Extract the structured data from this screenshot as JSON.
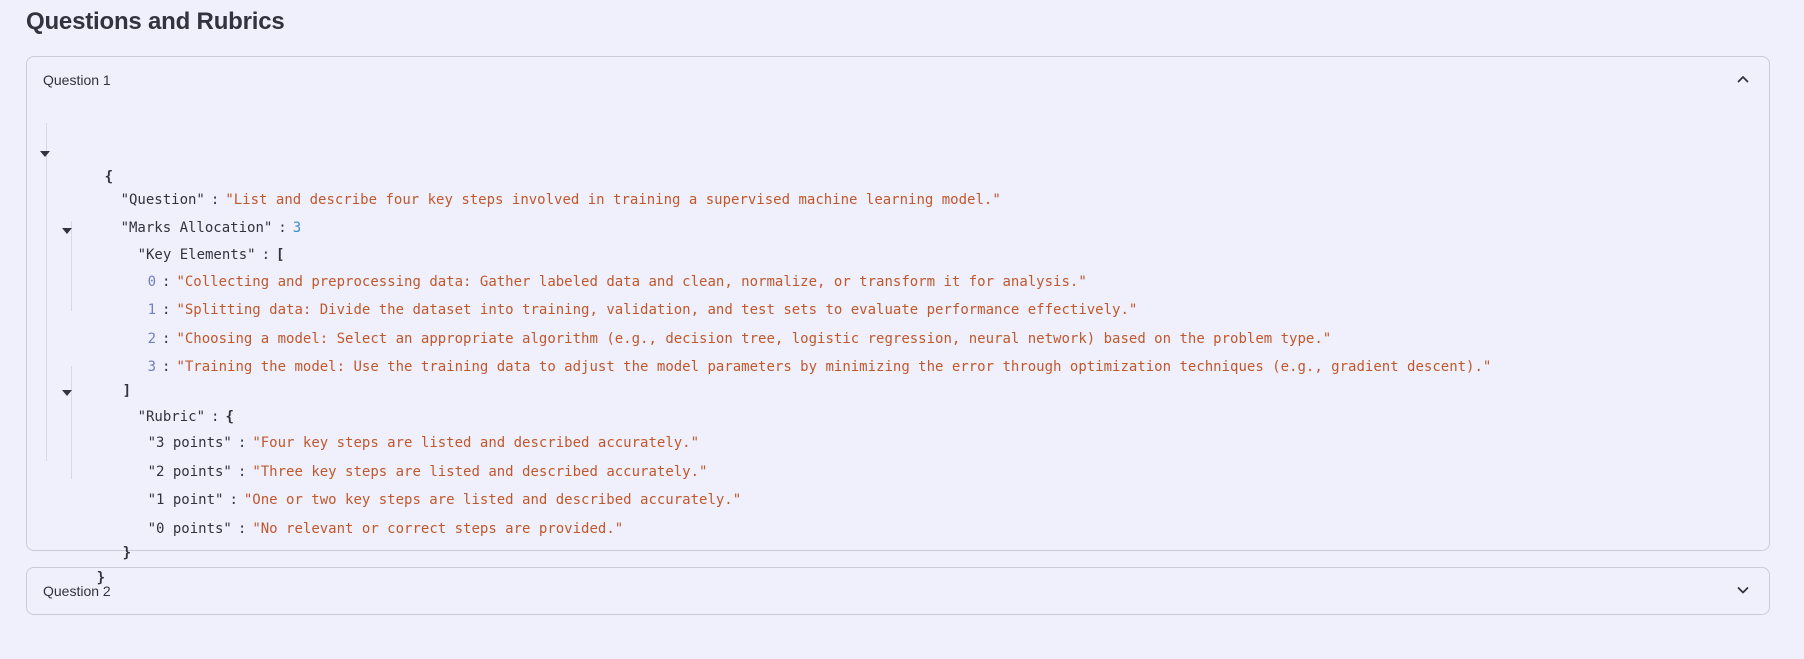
{
  "page": {
    "title": "Questions and Rubrics"
  },
  "expanders": [
    {
      "label": "Question 1",
      "expanded": true
    },
    {
      "label": "Question 2",
      "expanded": false
    }
  ],
  "json_view": {
    "open_brace": "{",
    "close_brace": "}",
    "question_key": "\"Question\"",
    "question_value": "\"List and describe four key steps involved in training a supervised machine learning model.\"",
    "marks_key": "\"Marks Allocation\"",
    "marks_value": "3",
    "key_elements_key": "\"Key Elements\"",
    "open_bracket": "[",
    "close_bracket": "]",
    "key_elements": [
      {
        "index": "0",
        "value": "\"Collecting and preprocessing data: Gather labeled data and clean, normalize, or transform it for analysis.\""
      },
      {
        "index": "1",
        "value": "\"Splitting data: Divide the dataset into training, validation, and test sets to evaluate performance effectively.\""
      },
      {
        "index": "2",
        "value": "\"Choosing a model: Select an appropriate algorithm (e.g., decision tree, logistic regression, neural network) based on the problem type.\""
      },
      {
        "index": "3",
        "value": "\"Training the model: Use the training data to adjust the model parameters by minimizing the error through optimization techniques (e.g., gradient descent).\""
      }
    ],
    "rubric_key": "\"Rubric\"",
    "rubric": [
      {
        "key": "\"3 points\"",
        "value": "\"Four key steps are listed and described accurately.\""
      },
      {
        "key": "\"2 points\"",
        "value": "\"Three key steps are listed and described accurately.\""
      },
      {
        "key": "\"1 point\"",
        "value": "\"One or two key steps are listed and described accurately.\""
      },
      {
        "key": "\"0 points\"",
        "value": "\"No relevant or correct steps are provided.\""
      }
    ],
    "colon": ":"
  },
  "icons": {
    "collapse": "chevron-up-icon",
    "expand": "chevron-down-icon",
    "toggle": "triangle-down-icon"
  },
  "colors": {
    "background": "#eff0fc",
    "string": "#c0582e",
    "number": "#3a8cc4",
    "index": "#6f80c0",
    "border": "#c9cbd8"
  }
}
